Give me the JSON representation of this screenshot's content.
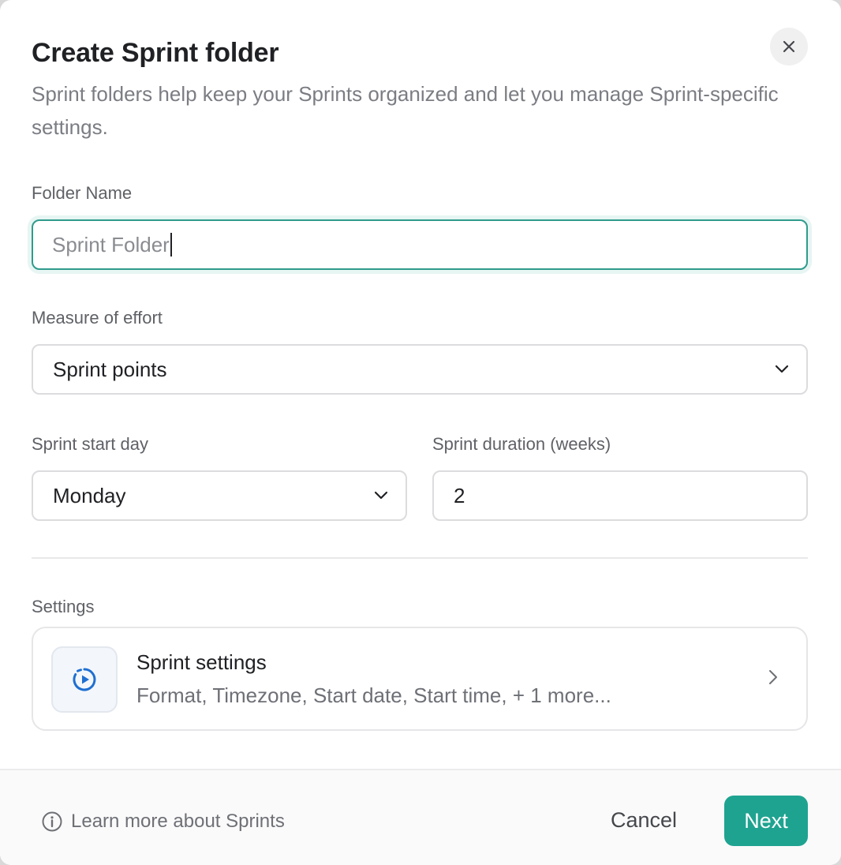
{
  "dialog": {
    "title": "Create Sprint folder",
    "subtitle": "Sprint folders help keep your Sprints organized and let you manage Sprint-specific settings.",
    "close_icon": "close-icon"
  },
  "form": {
    "folder_name": {
      "label": "Folder Name",
      "placeholder": "Sprint Folder",
      "value": ""
    },
    "measure_of_effort": {
      "label": "Measure of effort",
      "selected": "Sprint points"
    },
    "sprint_start_day": {
      "label": "Sprint start day",
      "selected": "Monday"
    },
    "sprint_duration": {
      "label": "Sprint duration (weeks)",
      "value": "2"
    }
  },
  "settings": {
    "section_label": "Settings",
    "card": {
      "icon": "sprint-play-icon",
      "title": "Sprint settings",
      "description": "Format, Timezone, Start date, Start time, + 1 more..."
    }
  },
  "footer": {
    "learn_more": "Learn more about Sprints",
    "cancel_label": "Cancel",
    "next_label": "Next"
  },
  "colors": {
    "accent": "#1fa391",
    "focus_border": "#2f9b8c",
    "icon_blue": "#1f6fd1"
  }
}
